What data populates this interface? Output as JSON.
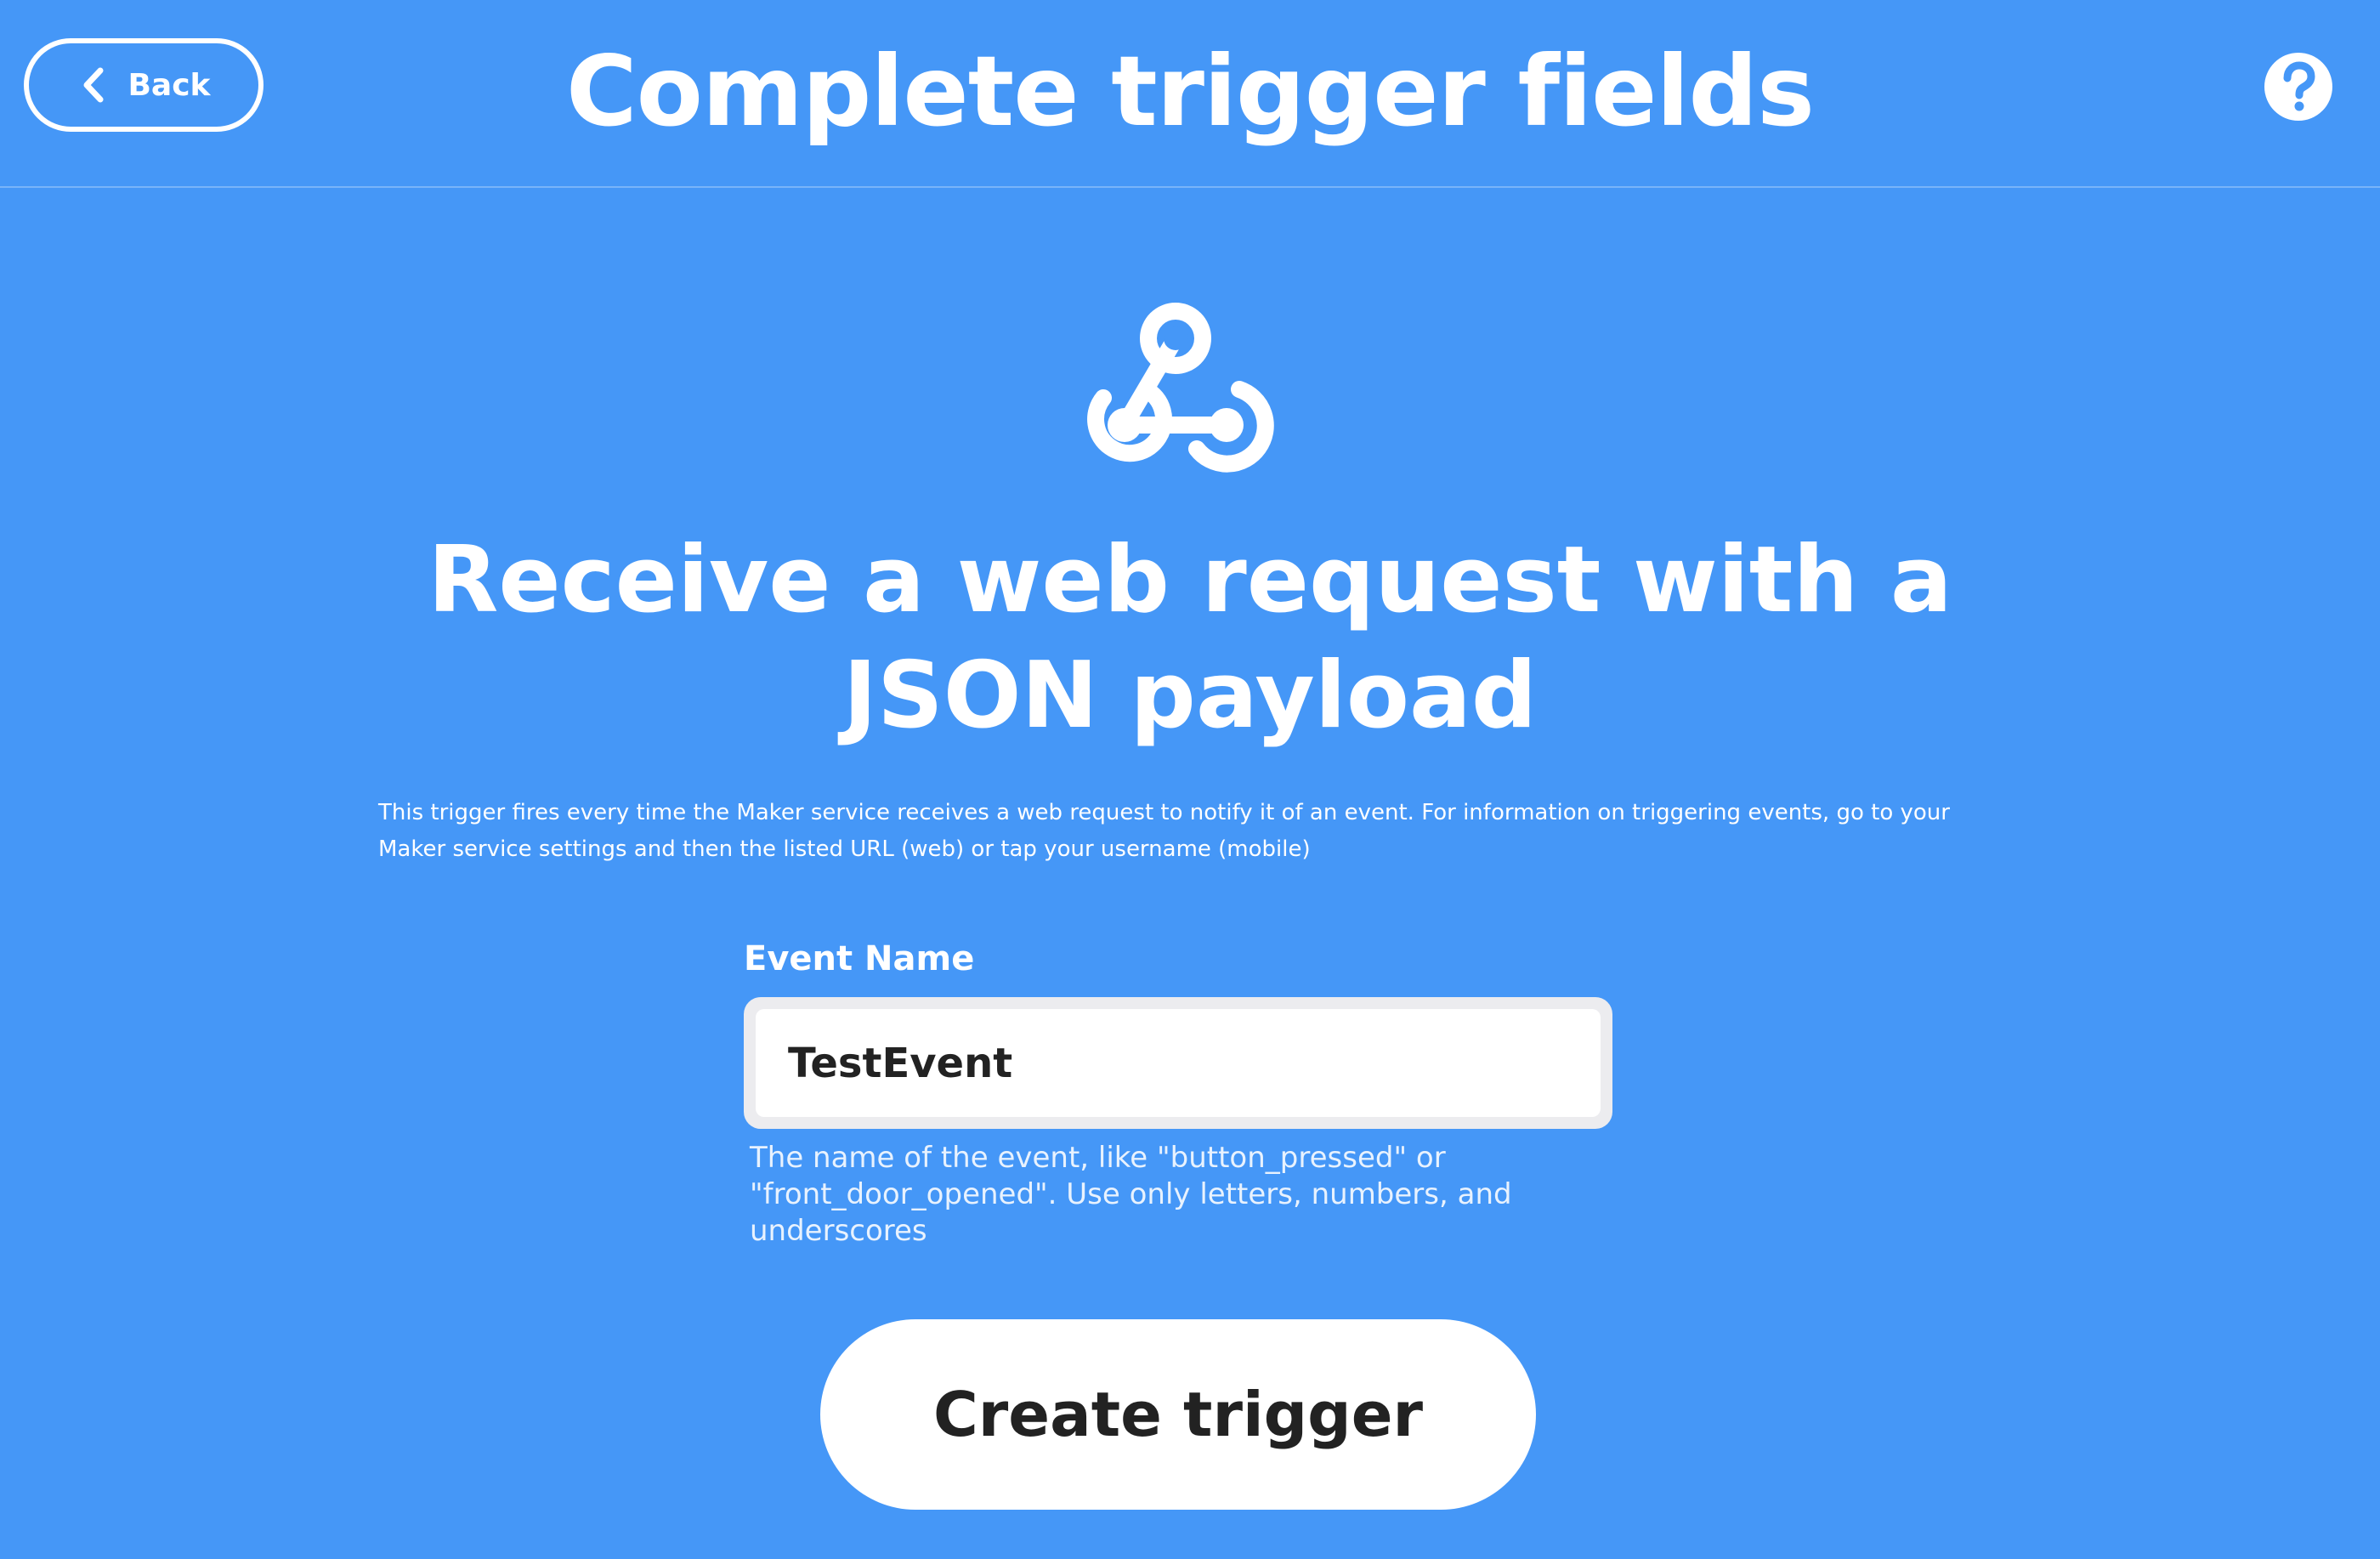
{
  "header": {
    "back_label": "Back",
    "title": "Complete trigger fields",
    "help_icon": "question-mark-circle-icon"
  },
  "service": {
    "icon": "webhooks-icon"
  },
  "trigger": {
    "title": "Receive a web request with a JSON payload",
    "description": "This trigger fires every time the Maker service receives a web request to notify it of an event. For information on triggering events, go to your Maker service settings and then the listed URL (web) or tap your username (mobile)"
  },
  "field": {
    "label": "Event Name",
    "value": "TestEvent",
    "help": "The name of the event, like \"button_pressed\" or \"front_door_opened\". Use only letters, numbers, and underscores"
  },
  "actions": {
    "create_label": "Create trigger"
  },
  "colors": {
    "background": "#4597f7",
    "foreground": "#ffffff",
    "button_text": "#222222"
  }
}
